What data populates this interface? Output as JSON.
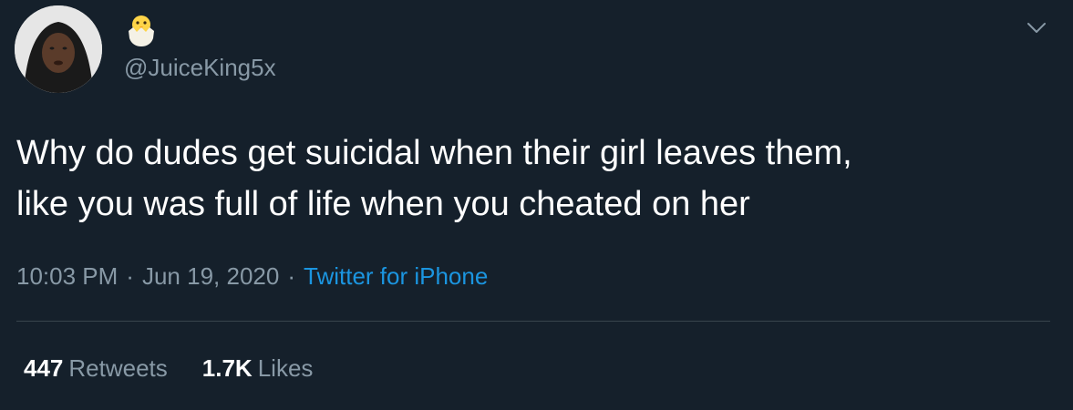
{
  "author": {
    "display_name_icon": "hatching-chick-emoji",
    "handle": "@JuiceKing5x",
    "avatar_icon": "profile-photo"
  },
  "menu": {
    "icon": "chevron-down-icon"
  },
  "tweet": {
    "lines": [
      "Why do dudes get suicidal when their girl leaves them,",
      "like you was full of life when you cheated on her"
    ]
  },
  "meta": {
    "time": "10:03 PM",
    "separator": "·",
    "date": "Jun 19, 2020",
    "source": "Twitter for iPhone"
  },
  "stats": {
    "retweets_count": "447",
    "retweets_label": "Retweets",
    "likes_count": "1.7K",
    "likes_label": "Likes"
  },
  "colors": {
    "background": "#15202b",
    "secondary_text": "#8899a6",
    "link": "#1b95e0",
    "divider": "#38444d"
  }
}
